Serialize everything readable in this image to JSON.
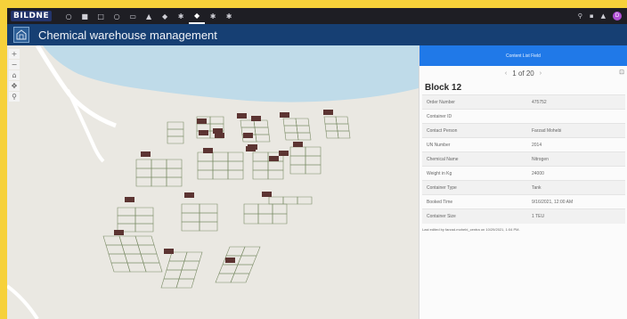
{
  "topbar": {
    "logo": "BILDNE",
    "tools": [
      {
        "icon": "circle-icon",
        "glyph": "○"
      },
      {
        "icon": "folder-icon",
        "glyph": "■"
      },
      {
        "icon": "monitor-icon",
        "glyph": "□"
      },
      {
        "icon": "circle-outline-icon",
        "glyph": "○"
      },
      {
        "icon": "calendar-icon",
        "glyph": "▭"
      },
      {
        "icon": "building-icon",
        "glyph": "▲"
      },
      {
        "icon": "factory-icon",
        "glyph": "◆"
      },
      {
        "icon": "gear-icon",
        "glyph": "✱"
      },
      {
        "icon": "warehouse-icon",
        "glyph": "◆",
        "active": true
      },
      {
        "icon": "tank-icon",
        "glyph": "✱"
      },
      {
        "icon": "grid-icon",
        "glyph": "✱"
      }
    ],
    "right_tools": [
      "search-icon",
      "notification-icon",
      "bell-icon"
    ],
    "avatar_initial": "D"
  },
  "app": {
    "title": "Chemical warehouse management"
  },
  "map": {
    "zoom_controls": [
      "+",
      "−",
      "⌂",
      "✥",
      "⚲"
    ]
  },
  "popup": {
    "header": "Content List Field",
    "pager": "1 of 20",
    "title": "Block 12",
    "rows": [
      {
        "label": "Order Number",
        "value": "475752"
      },
      {
        "label": "Container ID",
        "value": ""
      },
      {
        "label": "Contact Person",
        "value": "Farzad Mohebi"
      },
      {
        "label": "UN Number",
        "value": "2014"
      },
      {
        "label": "Chemical Name",
        "value": "Nitrogen"
      },
      {
        "label": "Weight in Kg",
        "value": "24000"
      },
      {
        "label": "Container Type",
        "value": "Tank"
      },
      {
        "label": "Booked Time",
        "value": "9/16/2021, 12:00 AM"
      },
      {
        "label": "Container Size",
        "value": "1 TEU"
      }
    ],
    "edited": "Last edited by farzad.mohebi_centra on 10/29/2021, 1:04 PM."
  },
  "colors": {
    "frame": "#f6d13a",
    "topbar": "#1e1e24",
    "appbar": "#163f73",
    "panel_header": "#2079e8",
    "water": "#bfdbe9",
    "container": "#5c3432"
  }
}
